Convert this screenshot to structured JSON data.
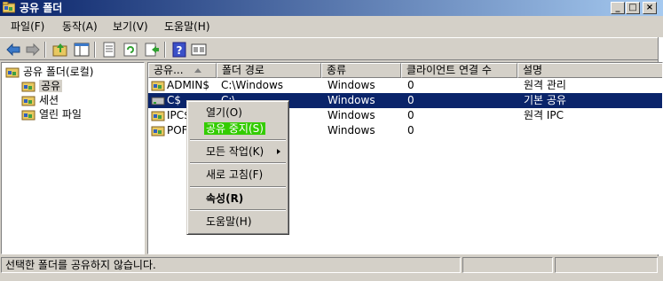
{
  "window": {
    "title": "공유 폴더",
    "controls": [
      "_",
      "□",
      "×"
    ]
  },
  "menubar": {
    "items": [
      "파일(F)",
      "동작(A)",
      "보기(V)",
      "도움말(H)"
    ]
  },
  "toolbar": {
    "buttons": [
      "back-icon",
      "forward-icon",
      "up-folder-icon",
      "show-tree-icon",
      "properties-icon",
      "refresh-icon",
      "export-icon",
      "help-icon",
      "view-icon"
    ]
  },
  "tree": {
    "root": "공유 폴더(로컬)",
    "items": [
      "공유",
      "세션",
      "열린 파일"
    ],
    "selected": "공유"
  },
  "list": {
    "columns": [
      "공유...",
      "폴더 경로",
      "종류",
      "클라이언트 연결 수",
      "설명"
    ],
    "rows": [
      {
        "name": "ADMIN$",
        "path": "C:\\Windows",
        "type": "Windows",
        "clients": "0",
        "desc": "원격 관리"
      },
      {
        "name": "C$",
        "path": "C:\\",
        "type": "Windows",
        "clients": "0",
        "desc": "기본 공유"
      },
      {
        "name": "IPC$",
        "path": "",
        "type": "Windows",
        "clients": "0",
        "desc": "원격 IPC"
      },
      {
        "name": "POF",
        "path": "",
        "type": "Windows",
        "clients": "0",
        "desc": ""
      }
    ],
    "selected_index": 1
  },
  "context_menu": {
    "items": [
      "열기(O)",
      "공유 중지(S)",
      "모든 작업(K)",
      "새로 고침(F)",
      "속성(R)",
      "도움말(H)"
    ],
    "highlighted": "공유 중지(S)"
  },
  "status": {
    "text": "선택한 폴더를 공유하지 않습니다."
  },
  "colors": {
    "title_start": "#0a246a",
    "title_end": "#a6caf0",
    "selection": "#0a246a",
    "menu_highlight": "#33cc00",
    "face": "#d4d0c8"
  }
}
